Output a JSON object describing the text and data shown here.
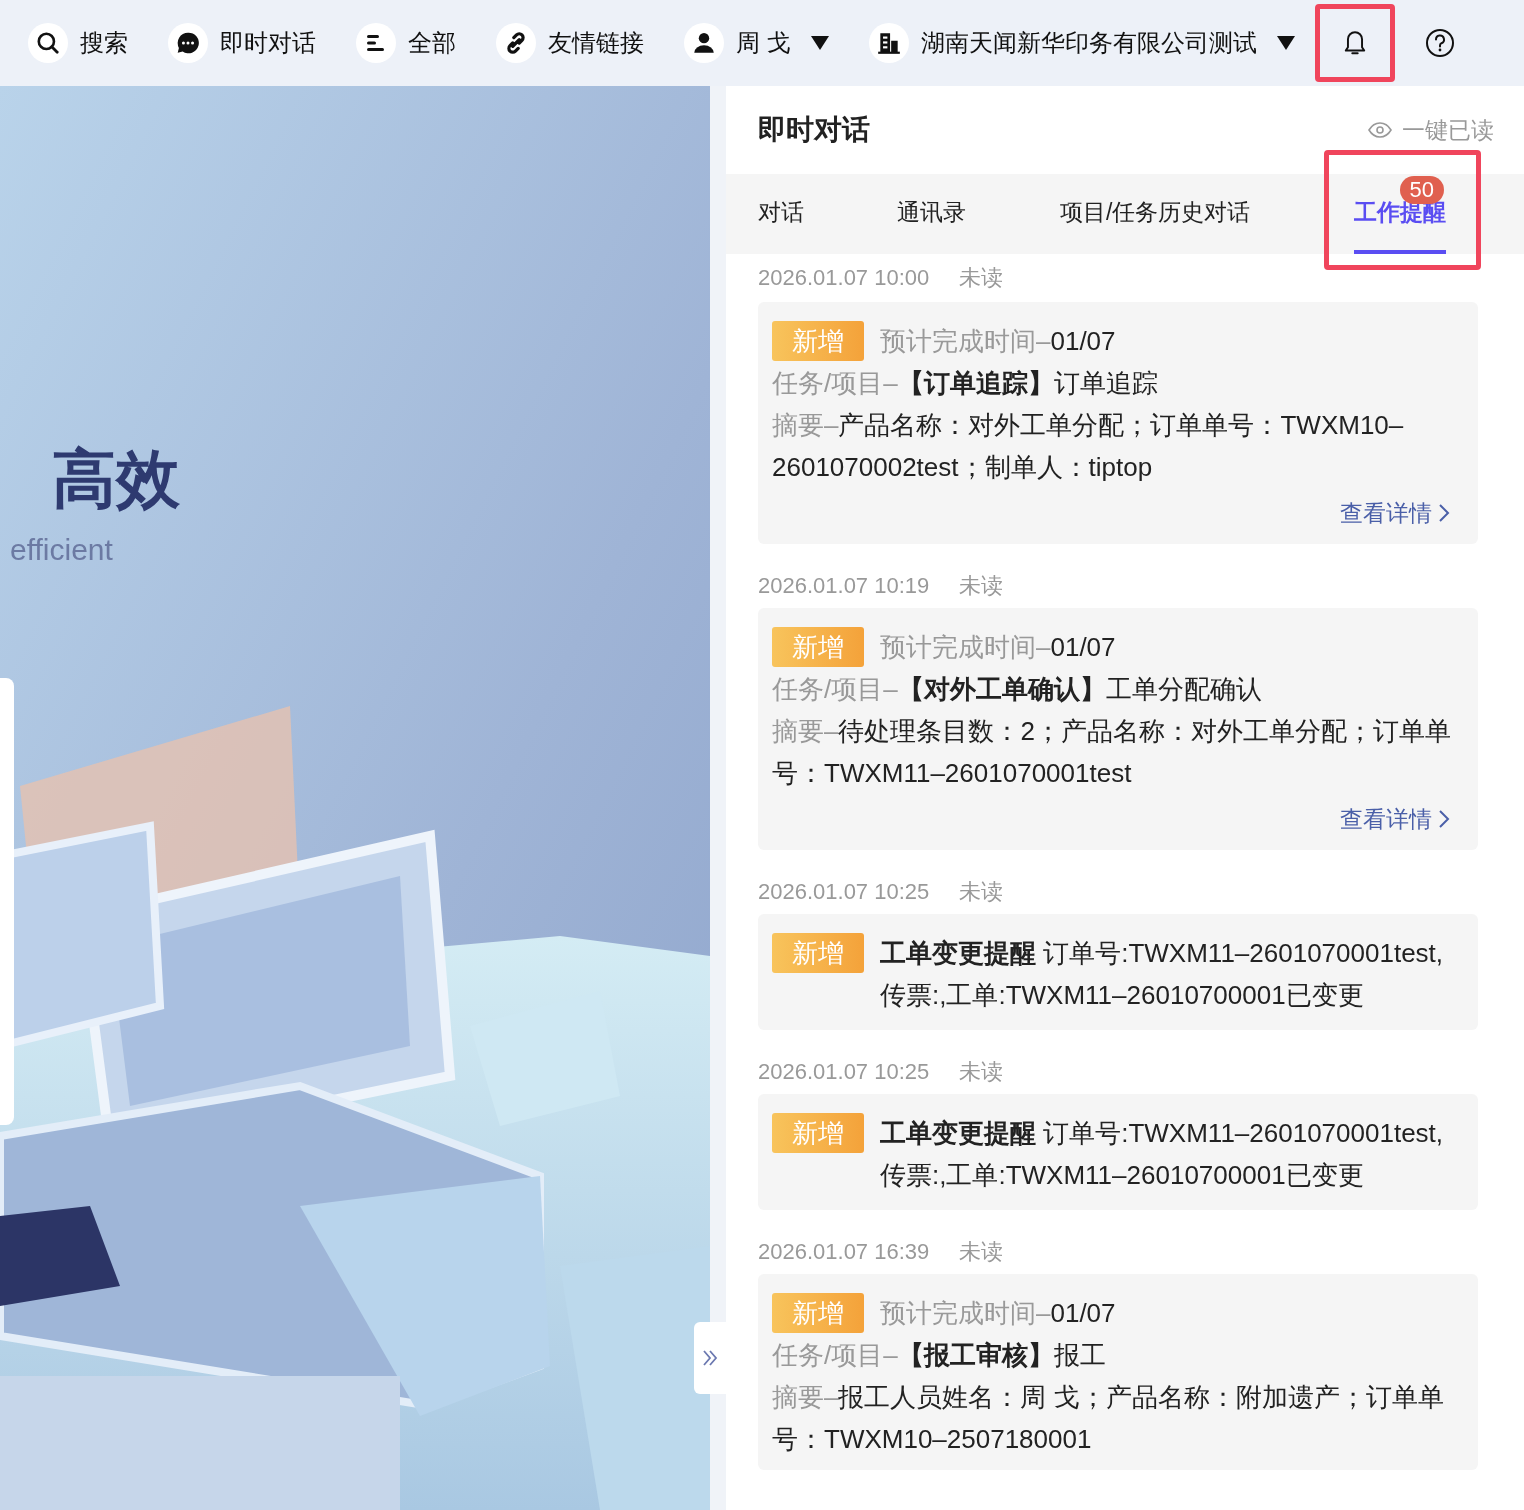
{
  "top_bar": {
    "items": [
      {
        "kind": "search",
        "label": "搜索"
      },
      {
        "kind": "chat",
        "label": "即时对话"
      },
      {
        "kind": "menu",
        "label": "全部"
      },
      {
        "kind": "link",
        "label": "友情链接"
      },
      {
        "kind": "user",
        "label": "周 戈",
        "dropdown": true
      },
      {
        "kind": "company",
        "label": "湖南天闻新华印务有限公司测试",
        "dropdown": true
      }
    ],
    "bell": {
      "highlighted": true
    }
  },
  "hero": {
    "title": "高效",
    "subtitle": "efficient"
  },
  "panel": {
    "title": "即时对话",
    "mark_all_read": "一键已读",
    "tabs": [
      {
        "label": "对话",
        "selected": false
      },
      {
        "label": "通讯录",
        "selected": false
      },
      {
        "label": "项目/任务历史对话",
        "selected": false
      },
      {
        "label": "工作提醒",
        "selected": true,
        "badge": "50",
        "highlighted": true
      }
    ],
    "messages": [
      {
        "time": "2026.01.07 10:00",
        "status": "未读",
        "kind": "task",
        "tag": "新增",
        "due_label": "预计完成时间–",
        "due": "01/07",
        "task_label": "任务/项目–",
        "task": "**【订单追踪】**订单追踪",
        "summary_label": "摘要–",
        "summary": "产品名称：对外工单分配；订单单号：TWXM10–2601070002test；制单人：tiptop",
        "link": "查看详情"
      },
      {
        "time": "2026.01.07 10:19",
        "status": "未读",
        "kind": "task",
        "tag": "新增",
        "due_label": "预计完成时间–",
        "due": "01/07",
        "task_label": "任务/项目–",
        "task": "**【对外工单确认】**工单分配确认",
        "summary_label": "摘要–",
        "summary": "待处理条目数：2；产品名称：对外工单分配；订单单号：TWXM11–2601070001test",
        "link": "查看详情"
      },
      {
        "time": "2026.01.07 10:25",
        "status": "未读",
        "kind": "change",
        "tag": "新增",
        "text": "**工单变更提醒** 订单号:TWXM11–2601070001test,传票:,工单:TWXM11–26010700001已变更"
      },
      {
        "time": "2026.01.07 10:25",
        "status": "未读",
        "kind": "change",
        "tag": "新增",
        "text": "**工单变更提醒** 订单号:TWXM11–2601070001test,传票:,工单:TWXM11–26010700001已变更"
      },
      {
        "time": "2026.01.07 16:39",
        "status": "未读",
        "kind": "task",
        "tag": "新增",
        "due_label": "预计完成时间–",
        "due": "01/07",
        "task_label": "任务/项目–",
        "task": "**【报工审核】**报工",
        "summary_label": "摘要–",
        "summary": "报工人员姓名：周 戈；产品名称：附加遗产；订单单号：TWXM10–2507180001"
      }
    ]
  }
}
